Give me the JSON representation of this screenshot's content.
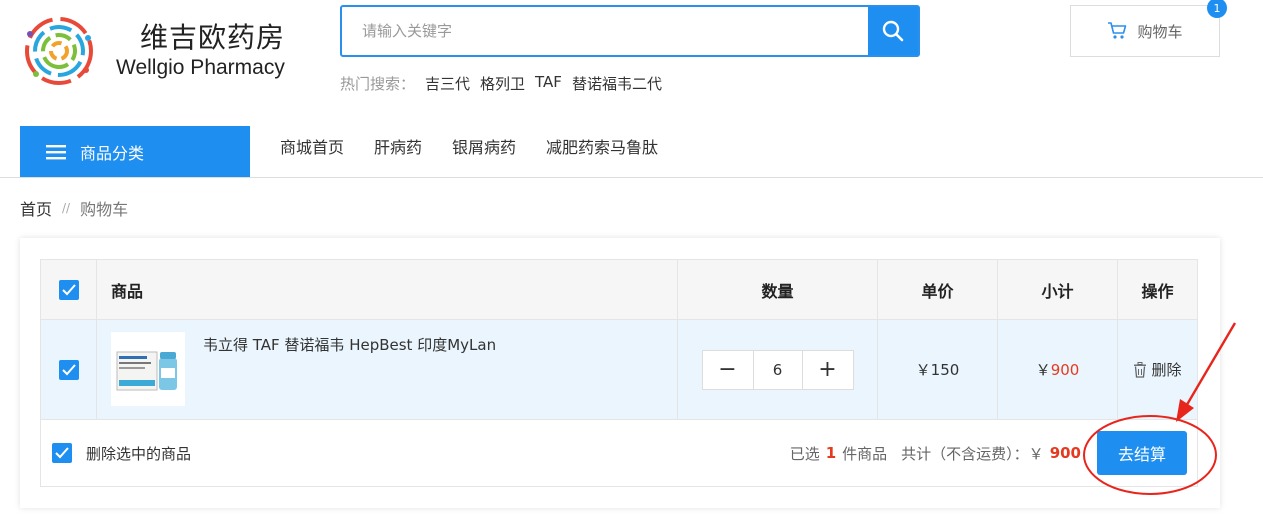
{
  "header": {
    "brand_cn": "维吉欧药房",
    "brand_en": "Wellgio Pharmacy",
    "search": {
      "placeholder": "请输入关键字"
    },
    "hot_label": "热门搜索：",
    "hot_items": [
      "吉三代",
      "格列卫",
      "TAF",
      "替诺福韦二代"
    ],
    "cart_label": "购物车",
    "cart_count": "1"
  },
  "nav": {
    "category_label": "商品分类",
    "links": [
      "商城首页",
      "肝病药",
      "银屑病药",
      "减肥药索马鲁肽"
    ]
  },
  "breadcrumb": {
    "home": "首页",
    "sep": "//",
    "current": "购物车"
  },
  "cart": {
    "columns": [
      "商品",
      "数量",
      "单价",
      "小计",
      "操作"
    ],
    "item": {
      "name": "韦立得 TAF 替诺福韦 HepBest 印度MyLan",
      "qty": "6",
      "minus": "−",
      "plus": "+",
      "price": "￥150",
      "subtotal_symbol": "￥",
      "subtotal_value": "900",
      "delete_label": "删除"
    },
    "footer": {
      "delete_selected": "删除选中的商品",
      "selected_prefix": "已选",
      "selected_count": "1",
      "selected_suffix": "件商品",
      "total_label": "共计（不含运费）：￥",
      "total_value": "900",
      "checkout_label": "去结算"
    }
  },
  "colors": {
    "primary": "#1e8ff0",
    "price_red": "#e53a1f",
    "annotation_red": "#e8251c"
  }
}
